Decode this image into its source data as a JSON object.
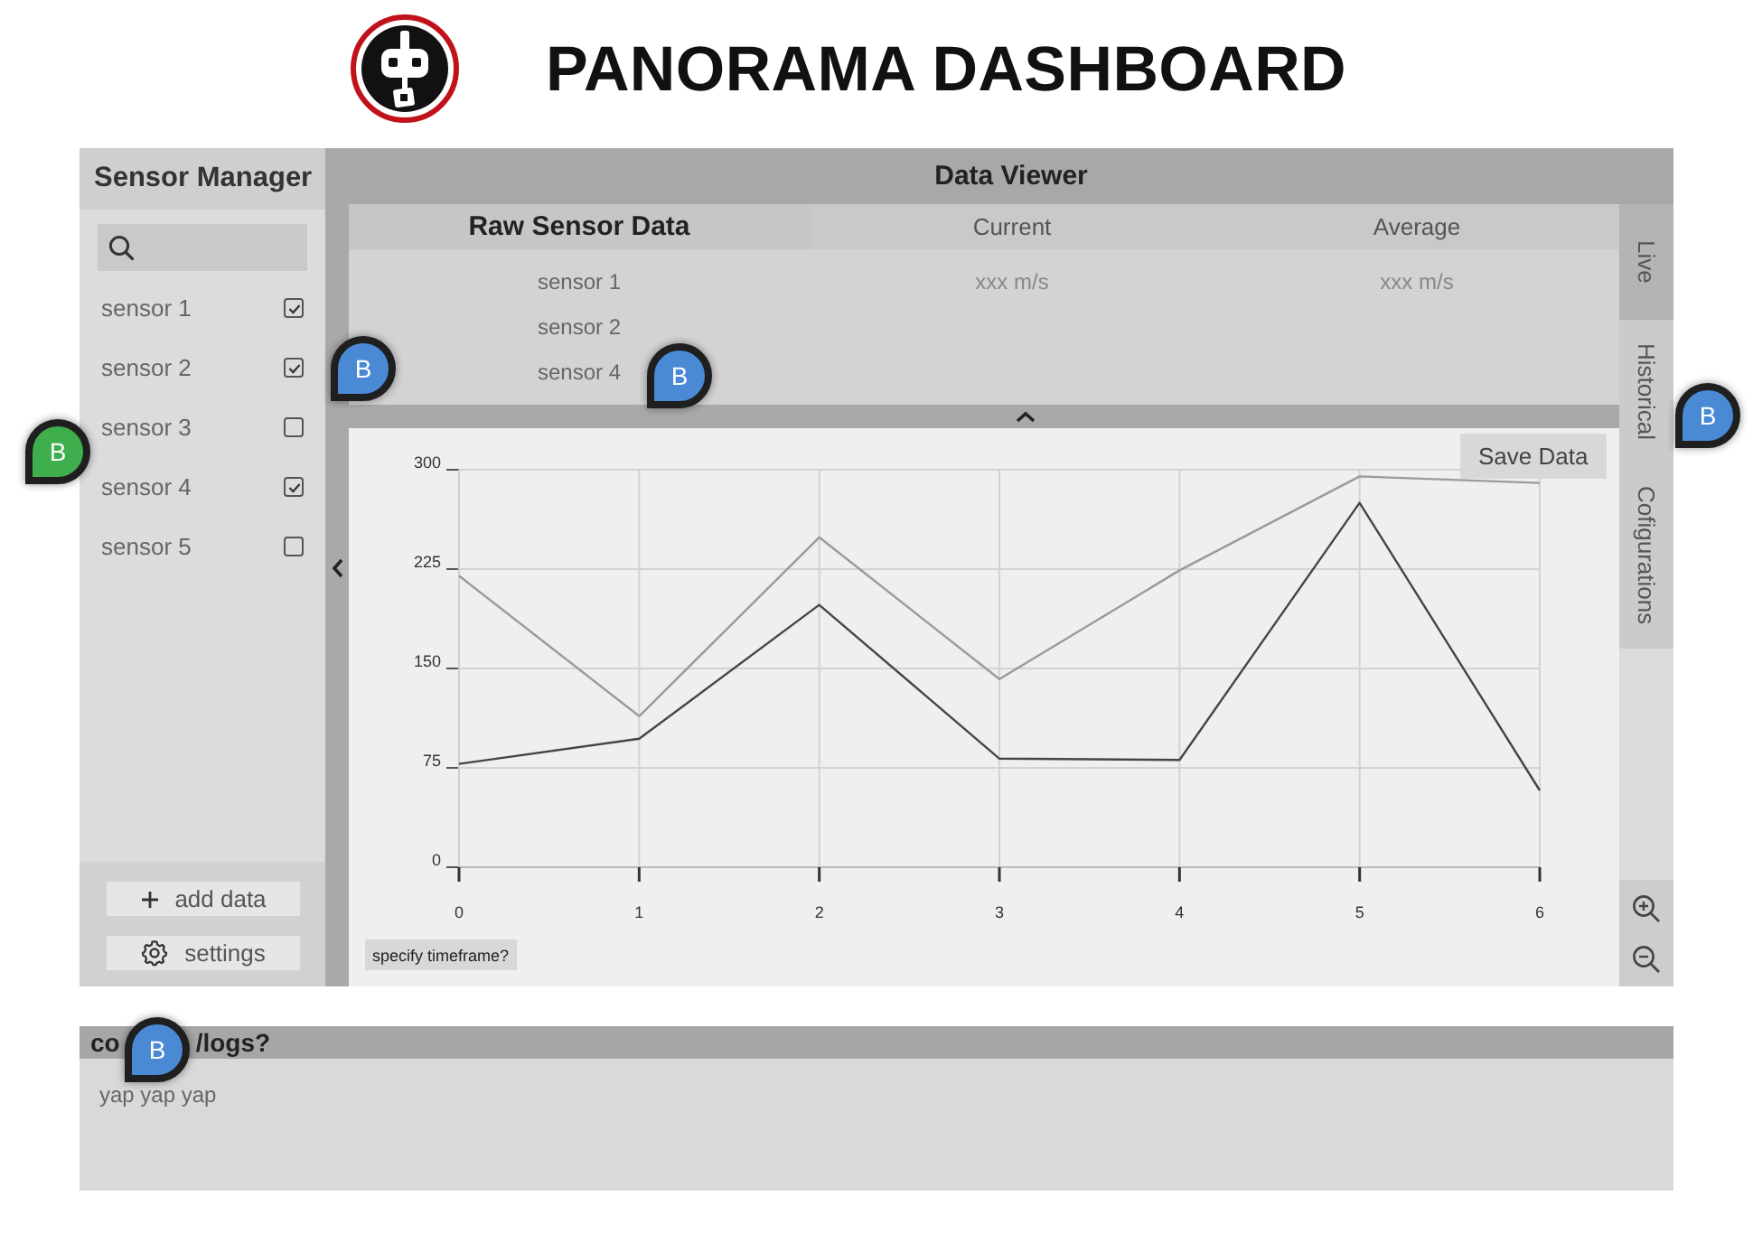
{
  "header": {
    "title": "PANORAMA DASHBOARD"
  },
  "sidebar": {
    "title": "Sensor Manager",
    "sensors": [
      {
        "name": "sensor 1",
        "checked": true
      },
      {
        "name": "sensor 2",
        "checked": true
      },
      {
        "name": "sensor 3",
        "checked": false
      },
      {
        "name": "sensor 4",
        "checked": true
      },
      {
        "name": "sensor 5",
        "checked": false
      }
    ],
    "buttons": [
      {
        "kind": "add",
        "label": "add data"
      },
      {
        "kind": "settings",
        "label": "settings"
      }
    ]
  },
  "data_viewer": {
    "title": "Data Viewer",
    "table": {
      "columns": [
        {
          "kind": "heading",
          "label": "Raw Sensor Data"
        },
        {
          "kind": "plain",
          "label": "Current"
        },
        {
          "kind": "plain",
          "label": "Average"
        }
      ],
      "rows": [
        [
          "sensor 1",
          "xxx m/s",
          "xxx m/s"
        ],
        [
          "sensor 2"
        ],
        [
          "sensor 4"
        ]
      ]
    },
    "chart": {
      "save_button": "Save Data",
      "timeframe_button": "specify timeframe?",
      "chart_data": {
        "type": "line",
        "x": [
          0,
          1,
          2,
          3,
          4,
          5,
          6
        ],
        "series": [
          {
            "color": "#9a9a9a",
            "values": [
              220,
              114,
              249,
              142,
              224,
              295,
              290
            ]
          },
          {
            "color": "#454545",
            "values": [
              78,
              97,
              198,
              82,
              81,
              275,
              58
            ]
          }
        ],
        "xlim": [
          0,
          6
        ],
        "ylim": [
          0,
          300
        ],
        "xticks": [
          0,
          1,
          2,
          3,
          4,
          5,
          6
        ],
        "yticks": [
          0,
          75,
          150,
          225,
          300
        ],
        "grid": true
      }
    },
    "tabs": [
      {
        "label": "Live",
        "selected": true
      },
      {
        "label": "Historical",
        "selected": false
      },
      {
        "label": "Cofigurations",
        "selected": false
      }
    ]
  },
  "console": {
    "title_parts": [
      "co",
      "/logs?"
    ],
    "text": "yap yap yap"
  },
  "comment_pins": [
    {
      "label": "B",
      "color": "#3fae4c"
    },
    {
      "label": "B",
      "color": "#4a89d4"
    },
    {
      "label": "B",
      "color": "#4a89d4"
    },
    {
      "label": "B",
      "color": "#4a89d4"
    },
    {
      "label": "B",
      "color": "#4a89d4"
    }
  ]
}
